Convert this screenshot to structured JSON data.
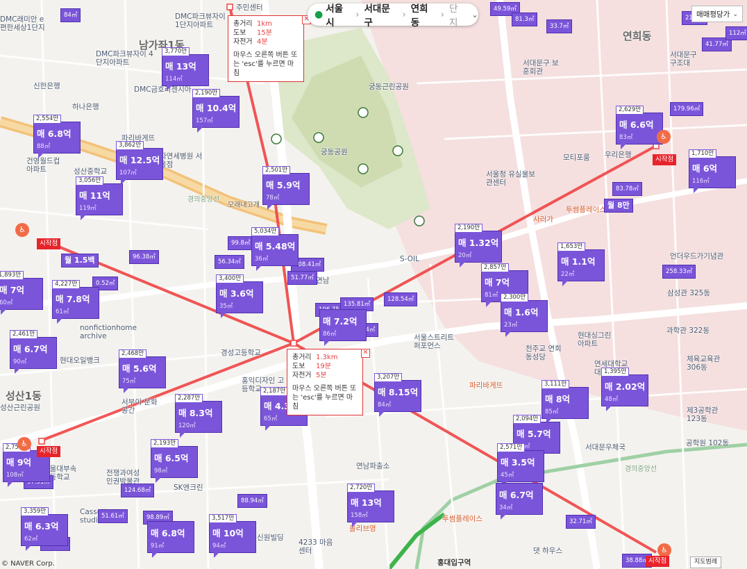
{
  "search_bar": {
    "city": "서울시",
    "district": "서대문구",
    "dong": "연희동",
    "danji_label": "단지"
  },
  "filter_select": {
    "value": "매매평당가"
  },
  "legend_button": "지도범례",
  "copyright": "© NAVER Corp.",
  "popups": [
    {
      "rows": [
        {
          "k": "총거리",
          "v": "1km"
        },
        {
          "k": "도보",
          "v": "15분"
        },
        {
          "k": "자전거",
          "v": "4분"
        }
      ],
      "note": "마우스 오른쪽 버튼 또는 'esc'를 누르면 마침",
      "close": "✕"
    },
    {
      "rows": [
        {
          "k": "총거리",
          "v": "1.3km"
        },
        {
          "k": "도보",
          "v": "19분"
        },
        {
          "k": "자전거",
          "v": "5분"
        }
      ],
      "note": "마우스 오른쪽 버튼 또는 'esc'를 누르면 마침",
      "close": "✕"
    }
  ],
  "start_label": "시작점",
  "markers": [
    {
      "price": "3,770만",
      "main": "매 13억",
      "area": "114㎡"
    },
    {
      "price": "2,190만",
      "main": "매 10.4억",
      "area": "157㎡"
    },
    {
      "price": "2,554만",
      "main": "매 6.8억",
      "area": "88㎡"
    },
    {
      "price": "3,862만",
      "main": "매 12.5억",
      "area": "107㎡"
    },
    {
      "price": "3,056만",
      "main": "매 11억",
      "area": "119㎡"
    },
    {
      "price": "2,501만",
      "main": "매 5.9억",
      "area": "78㎡"
    },
    {
      "price": "5,034만",
      "main": "매 5.48억",
      "area": "36㎡"
    },
    {
      "price": "3,400만",
      "main": "매 3.6억",
      "area": "35㎡"
    },
    {
      "price": "4,227만",
      "main": "매 7.8억",
      "area": "61㎡"
    },
    {
      "price": "2,461만",
      "main": "매 6.7억",
      "area": "90㎡"
    },
    {
      "price": "2,468만",
      "main": "매 5.6억",
      "area": "75㎡"
    },
    {
      "price": "2,287만",
      "main": "매 8.3억",
      "area": "120㎡"
    },
    {
      "price": "2,193만",
      "main": "매 6.5억",
      "area": "98㎡"
    },
    {
      "price": "3,359만",
      "main": "매 6.3억",
      "area": "62㎡"
    },
    {
      "price": "3,517만",
      "main": "매 10억",
      "area": "94㎡"
    },
    {
      "price": "2,187만",
      "main": "매 4.3억",
      "area": "65㎡"
    },
    {
      "price": "3,207만",
      "main": "매 8.15억",
      "area": "84㎡"
    },
    {
      "price": "2,720만",
      "main": "매 13억",
      "area": "158㎡"
    },
    {
      "price": "2,190만",
      "main": "매 1.32억",
      "area": "20㎡"
    },
    {
      "price": "2,857만",
      "main": "매 7억",
      "area": "81㎡"
    },
    {
      "price": "2,300만",
      "main": "매 1.6억",
      "area": "23㎡"
    },
    {
      "price": "1,653만",
      "main": "매 1.1억",
      "area": "22㎡"
    },
    {
      "price": "2,629만",
      "main": "매 6.6억",
      "area": "83㎡"
    },
    {
      "price": "1,710만",
      "main": "매 6억",
      "area": "116㎡"
    },
    {
      "price": "1,395만",
      "main": "매 2.02억",
      "area": "48㎡"
    },
    {
      "price": "3,111만",
      "main": "매 8억",
      "area": "85㎡"
    },
    {
      "price": "2,094만",
      "main": "매 5.7억",
      "area": "90㎡"
    },
    {
      "price": "2,571만",
      "main": "매 3.5억",
      "area": "45㎡"
    },
    {
      "price": "",
      "main": "매 6.7억",
      "area": "34㎡"
    },
    {
      "price": "2,755만",
      "main": "매 9억",
      "area": "108㎡"
    },
    {
      "price": "1,893만",
      "main": "매 7억",
      "area": "60㎡"
    },
    {
      "price": "",
      "main": "매 7.2억",
      "area": "86㎡"
    },
    {
      "price": "",
      "main": "매 6.8억",
      "area": "91㎡"
    }
  ],
  "minis": [
    "84㎡",
    "33.7㎡",
    "49.59㎡",
    "81.3㎡",
    "41.77㎡",
    "179.96㎡",
    "83.78㎡",
    "96.38㎡",
    "99.8㎡",
    "56.34㎡",
    "108.41㎡",
    "51.77㎡",
    "106.75㎡",
    "135.81㎡",
    "128.54㎡",
    "97.4㎡",
    "258.33㎡",
    "124.68㎡",
    "97.51㎡",
    "51.61㎡",
    "88.94㎡",
    "98.89㎡",
    "65.16㎡",
    "32.71㎡",
    "38.88㎡",
    "월 1.5백",
    "월 8만",
    "0.52㎡",
    "21.4㎡",
    "112㎡"
  ],
  "labels": {
    "districts": [
      "남가좌1동",
      "연희동",
      "성산1동"
    ],
    "pois": [
      "DMC래미안 e편한세상1단지",
      "DMC파크뷰자이 1단지아파트",
      "DMC파크뷰자이 4단지아파트",
      "DMC금호리젠시아",
      "신한은행",
      "하나은행",
      "파리바게뜨",
      "자연세병원 서울점",
      "건영월드컵 아파트",
      "성산중학교",
      "궁동근린공원",
      "궁동공원",
      "서대문구 보훈회관",
      "서울청 유실물보관센터",
      "모티포룸",
      "우리은행",
      "투썸플레이스",
      "사러가",
      "S-OIL",
      "언더우드가기념관",
      "삼성관 325동",
      "현대싱그린 아파트",
      "천주교 연희동성당",
      "연세대학교 대운동장",
      "서울스트리트 퍼포먼스",
      "경성고등학교",
      "홍익디자인 고등학교",
      "nonfictionhome archive",
      "현대오일뱅크",
      "서부이 문화공간",
      "전쟁과여성 인권박물관",
      "SK엔크린",
      "Cassette studio",
      "신원빌딩",
      "4233 마음센터",
      "올리브영",
      "연남파출소",
      "홍대입구역",
      "투썸플레이스",
      "댓 하우스",
      "서대문구 구조대",
      "과학관 322동",
      "체육교육관 306동",
      "제3공학관 123동",
      "공학원 102동",
      "서대문우체국",
      "성산근린공원",
      "서울대부속 고등학교",
      "파리바게뜨",
      "연남",
      "모래내고개",
      "주민센터"
    ],
    "roads": [
      "경의중앙선",
      "경의중앙선"
    ]
  }
}
